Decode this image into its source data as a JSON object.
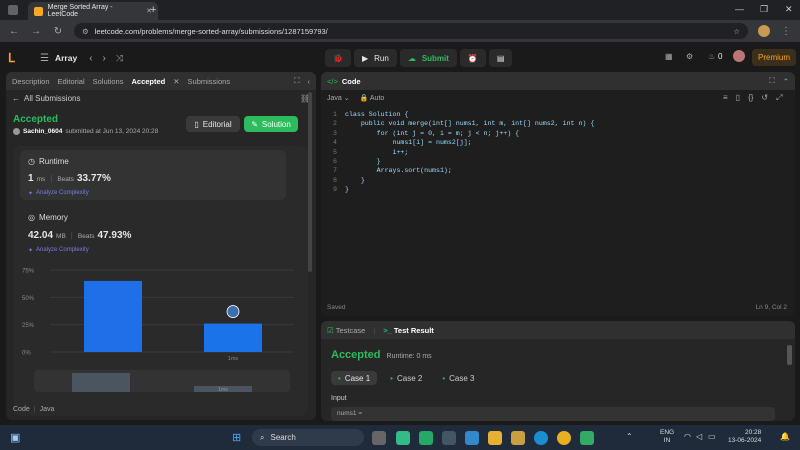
{
  "browser": {
    "tab_title": "Merge Sorted Array - LeetCode",
    "new_tab": "+",
    "url": "leetcode.com/problems/merge-sorted-array/submissions/1287159793/"
  },
  "topbar": {
    "problem_list": "Array",
    "run": "Run",
    "submit": "Submit",
    "streak": "0",
    "premium": "Premium"
  },
  "left_tabs": [
    "Description",
    "Editorial",
    "Solutions",
    "Accepted",
    "Submissions"
  ],
  "submission": {
    "back": "All Submissions",
    "status": "Accepted",
    "user": "Sachin_0604",
    "submitted": "submitted at Jun 13, 2024 20:28",
    "editorial_btn": "Editorial",
    "solution_btn": "Solution",
    "runtime_title": "Runtime",
    "runtime_value": "1",
    "runtime_unit": "ms",
    "runtime_beats_label": "Beats",
    "runtime_beats": "33.77%",
    "analyze": "Analyze Complexity",
    "memory_title": "Memory",
    "memory_value": "42.04",
    "memory_unit": "MB",
    "memory_beats_label": "Beats",
    "memory_beats": "47.93%",
    "analyze2": "Analyze Complexity",
    "bottom_left": "Code",
    "bottom_lang": "Java"
  },
  "chart_data": {
    "type": "bar",
    "yticks": [
      "75%",
      "50%",
      "25%",
      "0%"
    ],
    "ylim": [
      0,
      75
    ],
    "values": [
      65,
      26
    ],
    "categories": [
      "",
      "1ms"
    ],
    "highlight_index": 1,
    "mini_label": "1ms",
    "colors": {
      "bar": "#1e6fe8",
      "highlight": "#1a73e8"
    }
  },
  "code_panel": {
    "title": "Code",
    "lang": "Java",
    "auto": "Auto",
    "saved": "Saved",
    "cursor": "Ln 9, Col 2",
    "lines": [
      "class Solution {",
      "    public void merge(int[] nums1, int m, int[] nums2, int n) {",
      "        for (int j = 0, i = m; j < n; j++) {",
      "            nums1[i] = nums2[j];",
      "            i++;",
      "        }",
      "        Arrays.sort(nums1);",
      "    }",
      "}"
    ],
    "line_numbers": [
      "1",
      "2",
      "3",
      "4",
      "5",
      "6",
      "7",
      "8",
      "9"
    ]
  },
  "result_panel": {
    "testcase_tab": "Testcase",
    "result_tab": "Test Result",
    "status": "Accepted",
    "runtime": "Runtime: 0 ms",
    "cases": [
      "Case 1",
      "Case 2",
      "Case 3"
    ],
    "input_label": "Input",
    "input_var": "nums1 ="
  },
  "taskbar": {
    "search": "Search",
    "lang1": "ENG",
    "lang2": "IN",
    "time": "20:28",
    "date": "13-06-2024"
  },
  "colors": {
    "accent_green": "#2cbb5d",
    "accent_blue": "#1e6fe8",
    "premium": "#ffa116"
  }
}
